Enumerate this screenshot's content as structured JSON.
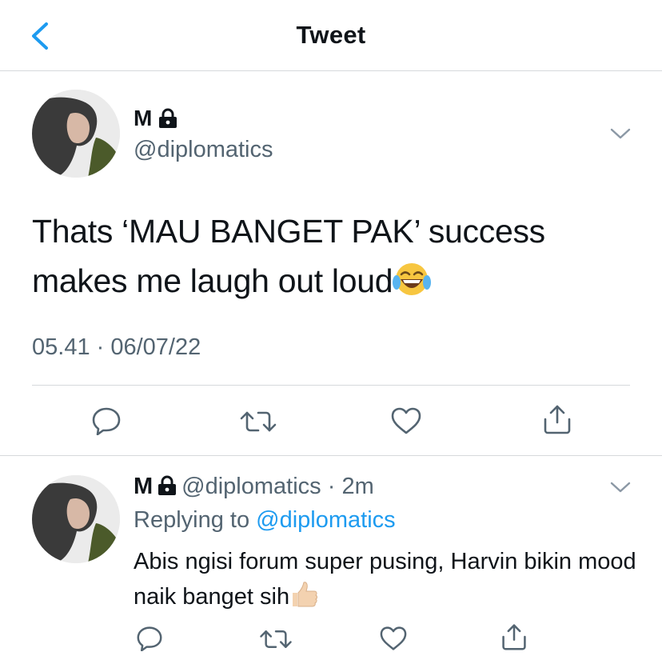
{
  "header": {
    "title": "Tweet"
  },
  "main_tweet": {
    "author_name": "M",
    "handle": "@diplomatics",
    "text": "Thats ‘MAU BANGET PAK’ success makes me laugh out loud",
    "text_emoji": "face-with-tears-of-joy",
    "timestamp": "05.41 · 06/07/22"
  },
  "reply_tweet": {
    "author_name": "M",
    "handle": "@diplomatics",
    "separator": " · ",
    "time_ago": "2m",
    "replying_prefix": "Replying to ",
    "replying_to": "@diplomatics",
    "text": "Abis ngisi forum super pusing, Harvin bikin mood naik banget sih",
    "text_emoji": "thumbs-up-light-skin-tone"
  },
  "colors": {
    "accent": "#1d9bf0",
    "secondary_text": "#536471",
    "divider": "#d6d9dc"
  }
}
